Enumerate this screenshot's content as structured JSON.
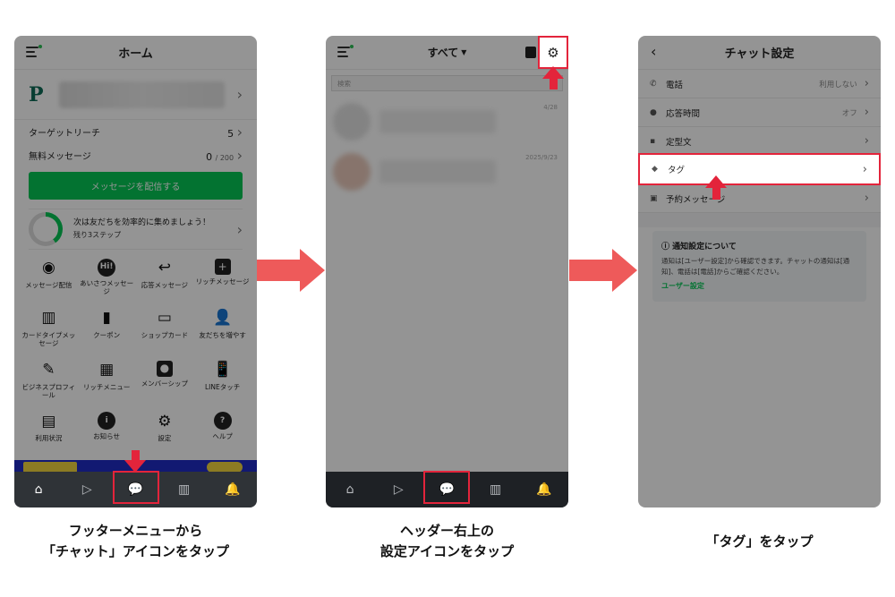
{
  "colors": {
    "highlight": "#e3243b",
    "line_green": "#06c755",
    "flow_arrow": "#ee5a5a",
    "footer_bg": "#2f3337"
  },
  "phone1": {
    "header_title": "ホーム",
    "stats": [
      {
        "label": "ターゲットリーチ",
        "value": "5",
        "max": ""
      },
      {
        "label": "無料メッセージ",
        "value": "0",
        "max": "/ 200"
      }
    ],
    "send_button": "メッセージを配信する",
    "tip": {
      "title": "次は友だちを効率的に集めましょう！",
      "sub": "残り3ステップ"
    },
    "menu": [
      {
        "icon": "broadcast-icon",
        "label": "メッセージ配信"
      },
      {
        "icon": "greeting-icon",
        "label": "あいさつメッセージ"
      },
      {
        "icon": "reply-icon",
        "label": "応答メッセージ"
      },
      {
        "icon": "rich-message-icon",
        "label": "リッチメッセージ"
      },
      {
        "icon": "card-type-icon",
        "label": "カードタイプメッセージ"
      },
      {
        "icon": "coupon-icon",
        "label": "クーポン"
      },
      {
        "icon": "shop-card-icon",
        "label": "ショップカード"
      },
      {
        "icon": "add-friend-icon",
        "label": "友だちを増やす"
      },
      {
        "icon": "business-profile-icon",
        "label": "ビジネスプロフィール"
      },
      {
        "icon": "rich-menu-icon",
        "label": "リッチメニュー"
      },
      {
        "icon": "membership-icon",
        "label": "メンバーシップ"
      },
      {
        "icon": "line-touch-icon",
        "label": "LINEタッチ"
      },
      {
        "icon": "usage-icon",
        "label": "利用状況"
      },
      {
        "icon": "notice-icon",
        "label": "お知らせ"
      },
      {
        "icon": "settings-icon",
        "label": "設定"
      },
      {
        "icon": "help-icon",
        "label": "ヘルプ"
      }
    ],
    "caption": [
      "フッターメニューから",
      "「チャット」アイコンをタップ"
    ]
  },
  "phone2": {
    "header_title": "すべて",
    "search_placeholder": "検索",
    "chats": [
      {
        "date": "4/28"
      },
      {
        "date": "2025/9/23"
      }
    ],
    "caption": [
      "ヘッダー右上の",
      "設定アイコンをタップ"
    ]
  },
  "phone3": {
    "header_title": "チャット設定",
    "rows": [
      {
        "icon": "phone-icon",
        "label": "電話",
        "value": "利用しない"
      },
      {
        "icon": "clock-icon",
        "label": "応答時間",
        "value": "オフ"
      },
      {
        "icon": "template-icon",
        "label": "定型文",
        "value": ""
      },
      {
        "icon": "tag-icon",
        "label": "タグ",
        "value": ""
      },
      {
        "icon": "schedule-icon",
        "label": "予約メッセージ",
        "value": ""
      }
    ],
    "notice": {
      "title": "ⓘ 通知設定について",
      "body": "通知は[ユーザー設定]から確認できます。チャットの通知は[通知]、電話は[電話]からご確認ください。",
      "link": "ユーザー設定"
    },
    "caption": [
      "「タグ」をタップ"
    ]
  }
}
